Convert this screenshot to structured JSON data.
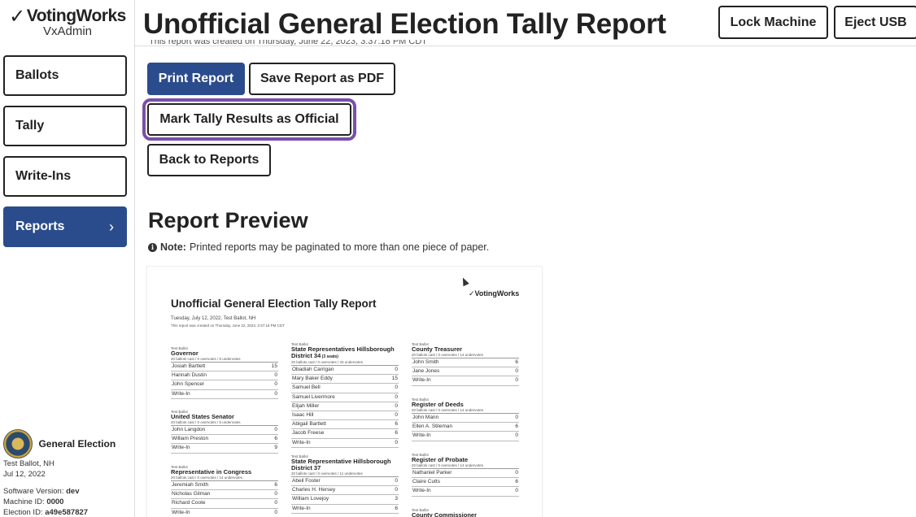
{
  "brand": {
    "logo_text": "VotingWorks",
    "product": "VxAdmin"
  },
  "header": {
    "title": "Unofficial General Election Tally Report",
    "lock_label": "Lock Machine",
    "eject_label": "Eject USB",
    "created_partial": "This report was created on Thursday, June 22, 2023, 3:37:18 PM CDT"
  },
  "sidebar": {
    "items": [
      {
        "label": "Ballots"
      },
      {
        "label": "Tally"
      },
      {
        "label": "Write-Ins"
      },
      {
        "label": "Reports",
        "active": true,
        "chevron": "›"
      }
    ],
    "election": {
      "title": "General Election",
      "line1": "Test Ballot, NH",
      "line2": "Jul 12, 2022"
    },
    "meta": {
      "software_label": "Software Version:",
      "software": "dev",
      "machine_label": "Machine ID:",
      "machine": "0000",
      "election_label": "Election ID:",
      "election_id": "a49e587827"
    }
  },
  "actions": {
    "print": "Print Report",
    "save_pdf": "Save Report as PDF",
    "mark_official": "Mark Tally Results as Official",
    "back": "Back to Reports"
  },
  "preview": {
    "title": "Report Preview",
    "note_bold": "Note:",
    "note_text": "Printed reports may be paginated to more than one piece of paper."
  },
  "report": {
    "title": "Unofficial General Election Tally Report",
    "logo": "VotingWorks",
    "subtitle": "Tuesday, July 12, 2022, Test Ballot, NH",
    "created": "This report was created on Thursday, June 22, 2023, 3:37:18 PM CDT",
    "contests": [
      {
        "ballot": "Test Ballot",
        "name": "Governor",
        "stats": "20 ballots cast / 0 overvotes / 5 undervotes",
        "rows": [
          [
            "Josiah Bartlett",
            "15"
          ],
          [
            "Hannah Dustin",
            "0"
          ],
          [
            "John Spencer",
            "0"
          ],
          [
            "Write-In",
            "0"
          ]
        ]
      },
      {
        "ballot": "Test Ballot",
        "name": "United States Senator",
        "stats": "20 ballots cast / 0 overvotes / 5 undervotes",
        "rows": [
          [
            "John Langdon",
            "0"
          ],
          [
            "William Preston",
            "6"
          ],
          [
            "Write-In",
            "9"
          ]
        ]
      },
      {
        "ballot": "Test Ballot",
        "name": "Representative in Congress",
        "stats": "20 ballots cast / 0 overvotes / 14 undervotes",
        "rows": [
          [
            "Jeremiah Smith",
            "6"
          ],
          [
            "Nicholas Gilman",
            "0"
          ],
          [
            "Richard Coote",
            "0"
          ],
          [
            "Write-In",
            "0"
          ]
        ]
      },
      {
        "ballot": "Test Ballot",
        "name": "State Representatives Hillsborough District 34",
        "seats": "(3 seats)",
        "stats": "20 ballots cast / 0 overvotes / 33 undervotes",
        "rows": [
          [
            "Obadiah Carrigan",
            "0"
          ],
          [
            "Mary Baker Eddy",
            "15"
          ],
          [
            "Samuel Bell",
            "0"
          ],
          [
            "Samuel Livermore",
            "0"
          ],
          [
            "Elijah Miller",
            "0"
          ],
          [
            "Isaac Hill",
            "0"
          ],
          [
            "Abigail Bartlett",
            "6"
          ],
          [
            "Jacob Freese",
            "6"
          ],
          [
            "Write-In",
            "0"
          ]
        ]
      },
      {
        "ballot": "Test Ballot",
        "name": "State Representative Hillsborough District 37",
        "stats": "20 ballots cast / 0 overvotes / 11 undervotes",
        "rows": [
          [
            "Abeil Foster",
            "0"
          ],
          [
            "Charles H. Hersey",
            "0"
          ],
          [
            "William Lovejoy",
            "3"
          ],
          [
            "Write-In",
            "6"
          ]
        ]
      },
      {
        "ballot": "Test Ballot",
        "name": "County Treasurer",
        "stats": "20 ballots cast / 0 overvotes / 14 undervotes",
        "rows": [
          [
            "John Smith",
            "6"
          ],
          [
            "Jane Jones",
            "0"
          ],
          [
            "Write-In",
            "0"
          ]
        ]
      },
      {
        "ballot": "Test Ballot",
        "name": "Register of Deeds",
        "stats": "20 ballots cast / 0 overvotes / 14 undervotes",
        "rows": [
          [
            "John Mann",
            "0"
          ],
          [
            "Ellen A. Stileman",
            "6"
          ],
          [
            "Write-In",
            "0"
          ]
        ]
      },
      {
        "ballot": "Test Ballot",
        "name": "Register of Probate",
        "stats": "20 ballots cast / 0 overvotes / 14 undervotes",
        "rows": [
          [
            "Nathaniel Parker",
            "0"
          ],
          [
            "Claire Cutts",
            "6"
          ],
          [
            "Write-In",
            "0"
          ]
        ]
      },
      {
        "ballot": "Test Ballot",
        "name": "County Commissioner",
        "stats": "",
        "rows": []
      }
    ]
  }
}
